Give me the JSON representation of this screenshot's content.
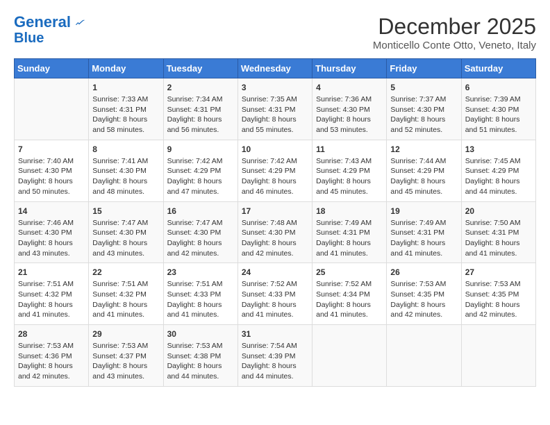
{
  "logo": {
    "line1": "General",
    "line2": "Blue"
  },
  "title": "December 2025",
  "location": "Monticello Conte Otto, Veneto, Italy",
  "days_of_week": [
    "Sunday",
    "Monday",
    "Tuesday",
    "Wednesday",
    "Thursday",
    "Friday",
    "Saturday"
  ],
  "weeks": [
    [
      {
        "day": "",
        "sunrise": "",
        "sunset": "",
        "daylight": ""
      },
      {
        "day": "1",
        "sunrise": "Sunrise: 7:33 AM",
        "sunset": "Sunset: 4:31 PM",
        "daylight": "Daylight: 8 hours and 58 minutes."
      },
      {
        "day": "2",
        "sunrise": "Sunrise: 7:34 AM",
        "sunset": "Sunset: 4:31 PM",
        "daylight": "Daylight: 8 hours and 56 minutes."
      },
      {
        "day": "3",
        "sunrise": "Sunrise: 7:35 AM",
        "sunset": "Sunset: 4:31 PM",
        "daylight": "Daylight: 8 hours and 55 minutes."
      },
      {
        "day": "4",
        "sunrise": "Sunrise: 7:36 AM",
        "sunset": "Sunset: 4:30 PM",
        "daylight": "Daylight: 8 hours and 53 minutes."
      },
      {
        "day": "5",
        "sunrise": "Sunrise: 7:37 AM",
        "sunset": "Sunset: 4:30 PM",
        "daylight": "Daylight: 8 hours and 52 minutes."
      },
      {
        "day": "6",
        "sunrise": "Sunrise: 7:39 AM",
        "sunset": "Sunset: 4:30 PM",
        "daylight": "Daylight: 8 hours and 51 minutes."
      }
    ],
    [
      {
        "day": "7",
        "sunrise": "Sunrise: 7:40 AM",
        "sunset": "Sunset: 4:30 PM",
        "daylight": "Daylight: 8 hours and 50 minutes."
      },
      {
        "day": "8",
        "sunrise": "Sunrise: 7:41 AM",
        "sunset": "Sunset: 4:30 PM",
        "daylight": "Daylight: 8 hours and 48 minutes."
      },
      {
        "day": "9",
        "sunrise": "Sunrise: 7:42 AM",
        "sunset": "Sunset: 4:29 PM",
        "daylight": "Daylight: 8 hours and 47 minutes."
      },
      {
        "day": "10",
        "sunrise": "Sunrise: 7:42 AM",
        "sunset": "Sunset: 4:29 PM",
        "daylight": "Daylight: 8 hours and 46 minutes."
      },
      {
        "day": "11",
        "sunrise": "Sunrise: 7:43 AM",
        "sunset": "Sunset: 4:29 PM",
        "daylight": "Daylight: 8 hours and 45 minutes."
      },
      {
        "day": "12",
        "sunrise": "Sunrise: 7:44 AM",
        "sunset": "Sunset: 4:29 PM",
        "daylight": "Daylight: 8 hours and 45 minutes."
      },
      {
        "day": "13",
        "sunrise": "Sunrise: 7:45 AM",
        "sunset": "Sunset: 4:29 PM",
        "daylight": "Daylight: 8 hours and 44 minutes."
      }
    ],
    [
      {
        "day": "14",
        "sunrise": "Sunrise: 7:46 AM",
        "sunset": "Sunset: 4:30 PM",
        "daylight": "Daylight: 8 hours and 43 minutes."
      },
      {
        "day": "15",
        "sunrise": "Sunrise: 7:47 AM",
        "sunset": "Sunset: 4:30 PM",
        "daylight": "Daylight: 8 hours and 43 minutes."
      },
      {
        "day": "16",
        "sunrise": "Sunrise: 7:47 AM",
        "sunset": "Sunset: 4:30 PM",
        "daylight": "Daylight: 8 hours and 42 minutes."
      },
      {
        "day": "17",
        "sunrise": "Sunrise: 7:48 AM",
        "sunset": "Sunset: 4:30 PM",
        "daylight": "Daylight: 8 hours and 42 minutes."
      },
      {
        "day": "18",
        "sunrise": "Sunrise: 7:49 AM",
        "sunset": "Sunset: 4:31 PM",
        "daylight": "Daylight: 8 hours and 41 minutes."
      },
      {
        "day": "19",
        "sunrise": "Sunrise: 7:49 AM",
        "sunset": "Sunset: 4:31 PM",
        "daylight": "Daylight: 8 hours and 41 minutes."
      },
      {
        "day": "20",
        "sunrise": "Sunrise: 7:50 AM",
        "sunset": "Sunset: 4:31 PM",
        "daylight": "Daylight: 8 hours and 41 minutes."
      }
    ],
    [
      {
        "day": "21",
        "sunrise": "Sunrise: 7:51 AM",
        "sunset": "Sunset: 4:32 PM",
        "daylight": "Daylight: 8 hours and 41 minutes."
      },
      {
        "day": "22",
        "sunrise": "Sunrise: 7:51 AM",
        "sunset": "Sunset: 4:32 PM",
        "daylight": "Daylight: 8 hours and 41 minutes."
      },
      {
        "day": "23",
        "sunrise": "Sunrise: 7:51 AM",
        "sunset": "Sunset: 4:33 PM",
        "daylight": "Daylight: 8 hours and 41 minutes."
      },
      {
        "day": "24",
        "sunrise": "Sunrise: 7:52 AM",
        "sunset": "Sunset: 4:33 PM",
        "daylight": "Daylight: 8 hours and 41 minutes."
      },
      {
        "day": "25",
        "sunrise": "Sunrise: 7:52 AM",
        "sunset": "Sunset: 4:34 PM",
        "daylight": "Daylight: 8 hours and 41 minutes."
      },
      {
        "day": "26",
        "sunrise": "Sunrise: 7:53 AM",
        "sunset": "Sunset: 4:35 PM",
        "daylight": "Daylight: 8 hours and 42 minutes."
      },
      {
        "day": "27",
        "sunrise": "Sunrise: 7:53 AM",
        "sunset": "Sunset: 4:35 PM",
        "daylight": "Daylight: 8 hours and 42 minutes."
      }
    ],
    [
      {
        "day": "28",
        "sunrise": "Sunrise: 7:53 AM",
        "sunset": "Sunset: 4:36 PM",
        "daylight": "Daylight: 8 hours and 42 minutes."
      },
      {
        "day": "29",
        "sunrise": "Sunrise: 7:53 AM",
        "sunset": "Sunset: 4:37 PM",
        "daylight": "Daylight: 8 hours and 43 minutes."
      },
      {
        "day": "30",
        "sunrise": "Sunrise: 7:53 AM",
        "sunset": "Sunset: 4:38 PM",
        "daylight": "Daylight: 8 hours and 44 minutes."
      },
      {
        "day": "31",
        "sunrise": "Sunrise: 7:54 AM",
        "sunset": "Sunset: 4:39 PM",
        "daylight": "Daylight: 8 hours and 44 minutes."
      },
      {
        "day": "",
        "sunrise": "",
        "sunset": "",
        "daylight": ""
      },
      {
        "day": "",
        "sunrise": "",
        "sunset": "",
        "daylight": ""
      },
      {
        "day": "",
        "sunrise": "",
        "sunset": "",
        "daylight": ""
      }
    ]
  ]
}
